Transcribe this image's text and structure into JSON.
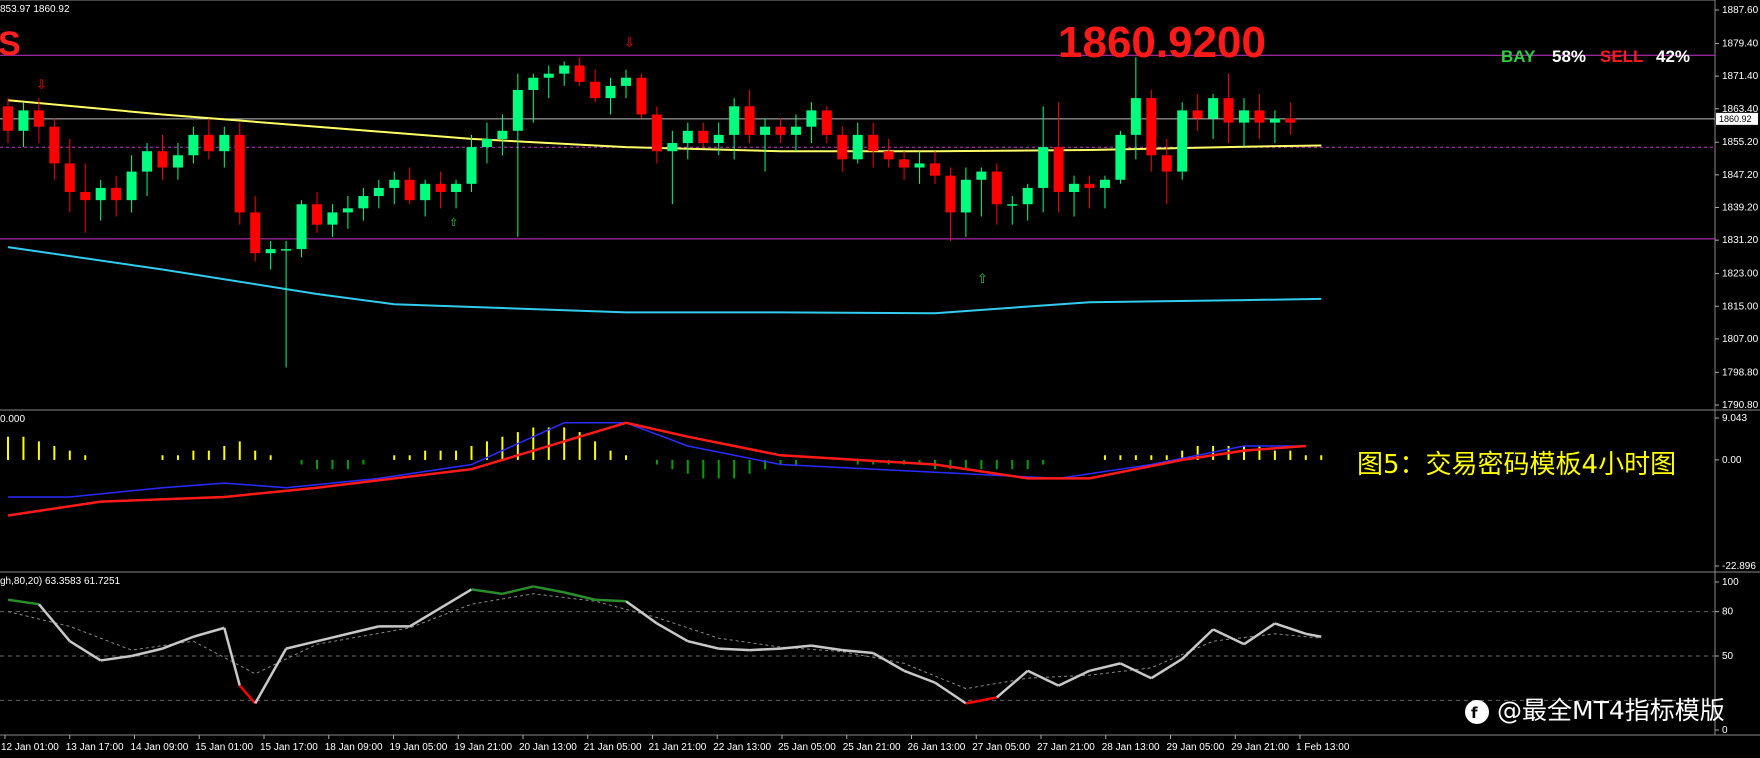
{
  "header": {
    "prices_text": "853.97 1860.92",
    "signal_letter": "S",
    "current_price_big": "1860.9200",
    "bay_label": "BAY",
    "bay_pct": "58%",
    "sell_label": "SELL",
    "sell_pct": "42%"
  },
  "annotation": "图5：交易密码模板4小时图",
  "watermark": "@最全MT4指标模版",
  "colors": {
    "bull": "#00ff7f",
    "bear": "#ff0000",
    "ma": "#ffff66",
    "band_low": "#33ccee",
    "band_line": "#cc33cc",
    "macd_main": "#ff1a1a",
    "macd_signal": "#2b2bff",
    "hist_pos": "#ffff00",
    "hist_neg": "#00a000",
    "stoch_main": "#c8c8c8",
    "stoch_up": "#2a8c2a",
    "stoch_down": "#ff0000",
    "text": "#ffffff",
    "annotation": "#ffff00",
    "price_big": "#ff0000"
  },
  "chart_data": [
    {
      "type": "candlestick",
      "ylim": [
        1790.8,
        1887.6
      ],
      "yticks": [
        "1887.60",
        "1879.40",
        "1871.40",
        "1863.40",
        "1855.20",
        "1847.20",
        "1839.20",
        "1831.20",
        "1823.00",
        "1815.00",
        "1807.00",
        "1798.80",
        "1790.80"
      ],
      "last_price_label": "1860.92",
      "xticks": [
        "12 Jan 01:00",
        "13 Jan 17:00",
        "14 Jan 09:00",
        "15 Jan 01:00",
        "15 Jan 17:00",
        "18 Jan 09:00",
        "19 Jan 05:00",
        "19 Jan 21:00",
        "20 Jan 13:00",
        "21 Jan 05:00",
        "21 Jan 21:00",
        "22 Jan 13:00",
        "25 Jan 05:00",
        "25 Jan 21:00",
        "26 Jan 13:00",
        "27 Jan 05:00",
        "27 Jan 21:00",
        "28 Jan 13:00",
        "29 Jan 05:00",
        "29 Jan 21:00",
        "1 Feb 13:00"
      ],
      "resistance": 1876.5,
      "support": 1831.5,
      "current_price": 1860.92,
      "dashed_level": 1853.97,
      "candles": [
        [
          1864,
          1866,
          1855,
          1858
        ],
        [
          1858,
          1865,
          1854,
          1863
        ],
        [
          1863,
          1866,
          1855,
          1859
        ],
        [
          1859,
          1861,
          1846,
          1850
        ],
        [
          1850,
          1856,
          1838,
          1843
        ],
        [
          1843,
          1850,
          1833,
          1841
        ],
        [
          1841,
          1846,
          1836,
          1844
        ],
        [
          1844,
          1847,
          1837,
          1841
        ],
        [
          1841,
          1852,
          1838,
          1848
        ],
        [
          1848,
          1855,
          1842,
          1853
        ],
        [
          1853,
          1857,
          1846,
          1849
        ],
        [
          1849,
          1855,
          1846,
          1852
        ],
        [
          1852,
          1859,
          1850,
          1857
        ],
        [
          1857,
          1861,
          1851,
          1853
        ],
        [
          1853,
          1859,
          1849,
          1857
        ],
        [
          1857,
          1860,
          1835,
          1838
        ],
        [
          1838,
          1842,
          1826,
          1828
        ],
        [
          1828,
          1831,
          1824,
          1829
        ],
        [
          1829,
          1831,
          1800,
          1829
        ],
        [
          1829,
          1841,
          1827,
          1840
        ],
        [
          1840,
          1843,
          1833,
          1835
        ],
        [
          1835,
          1840,
          1832,
          1838
        ],
        [
          1838,
          1842,
          1834,
          1839
        ],
        [
          1839,
          1844,
          1836,
          1842
        ],
        [
          1842,
          1846,
          1839,
          1844
        ],
        [
          1844,
          1848,
          1840,
          1846
        ],
        [
          1846,
          1849,
          1840,
          1841
        ],
        [
          1841,
          1846,
          1837,
          1845
        ],
        [
          1845,
          1848,
          1839,
          1843
        ],
        [
          1843,
          1846,
          1839,
          1845
        ],
        [
          1845,
          1857,
          1843,
          1854
        ],
        [
          1854,
          1860,
          1850,
          1856
        ],
        [
          1856,
          1862,
          1852,
          1858
        ],
        [
          1858,
          1872,
          1832,
          1868
        ],
        [
          1868,
          1872,
          1860,
          1871
        ],
        [
          1871,
          1874,
          1866,
          1872
        ],
        [
          1872,
          1875,
          1869,
          1874
        ],
        [
          1874,
          1876,
          1869,
          1870
        ],
        [
          1870,
          1873,
          1865,
          1866
        ],
        [
          1866,
          1871,
          1862,
          1869
        ],
        [
          1869,
          1873,
          1866,
          1871
        ],
        [
          1871,
          1872,
          1861,
          1862
        ],
        [
          1862,
          1864,
          1850,
          1853
        ],
        [
          1853,
          1858,
          1840,
          1855
        ],
        [
          1855,
          1860,
          1851,
          1858
        ],
        [
          1858,
          1860,
          1854,
          1855
        ],
        [
          1855,
          1860,
          1852,
          1857
        ],
        [
          1857,
          1866,
          1851,
          1864
        ],
        [
          1864,
          1868,
          1855,
          1857
        ],
        [
          1857,
          1861,
          1848,
          1859
        ],
        [
          1859,
          1861,
          1855,
          1857
        ],
        [
          1857,
          1862,
          1853,
          1859
        ],
        [
          1859,
          1865,
          1855,
          1863
        ],
        [
          1863,
          1864,
          1855,
          1857
        ],
        [
          1857,
          1859,
          1848,
          1851
        ],
        [
          1851,
          1860,
          1850,
          1857
        ],
        [
          1857,
          1860,
          1849,
          1853
        ],
        [
          1853,
          1856,
          1849,
          1851
        ],
        [
          1851,
          1853,
          1846,
          1849
        ],
        [
          1849,
          1853,
          1845,
          1850
        ],
        [
          1850,
          1853,
          1845,
          1847
        ],
        [
          1847,
          1849,
          1831,
          1838
        ],
        [
          1838,
          1849,
          1832,
          1846
        ],
        [
          1846,
          1849,
          1837,
          1848
        ],
        [
          1848,
          1850,
          1835,
          1840
        ],
        [
          1840,
          1842,
          1835,
          1840
        ],
        [
          1840,
          1845,
          1836,
          1844
        ],
        [
          1844,
          1864,
          1838,
          1854
        ],
        [
          1854,
          1865,
          1838,
          1843
        ],
        [
          1843,
          1847,
          1837,
          1845
        ],
        [
          1845,
          1847,
          1839,
          1844
        ],
        [
          1844,
          1847,
          1839,
          1846
        ],
        [
          1846,
          1858,
          1845,
          1857
        ],
        [
          1857,
          1876,
          1851,
          1866
        ],
        [
          1866,
          1868,
          1848,
          1852
        ],
        [
          1852,
          1856,
          1840,
          1848
        ],
        [
          1848,
          1865,
          1846,
          1863
        ],
        [
          1863,
          1867,
          1858,
          1861
        ],
        [
          1861,
          1867,
          1856,
          1866
        ],
        [
          1866,
          1872,
          1855,
          1860
        ],
        [
          1860,
          1866,
          1854,
          1863
        ],
        [
          1863,
          1867,
          1856,
          1860
        ],
        [
          1860,
          1863,
          1855,
          1861
        ],
        [
          1861,
          1865,
          1857,
          1860
        ]
      ],
      "ma": [
        [
          0,
          1865.5
        ],
        [
          10,
          1862
        ],
        [
          20,
          1859
        ],
        [
          30,
          1856
        ],
        [
          40,
          1854
        ],
        [
          50,
          1853
        ],
        [
          60,
          1853
        ],
        [
          70,
          1853.3
        ],
        [
          80,
          1854.1
        ],
        [
          85,
          1854.4
        ]
      ],
      "lower_band": [
        [
          0,
          1829.5
        ],
        [
          10,
          1824
        ],
        [
          20,
          1818
        ],
        [
          25,
          1815.5
        ],
        [
          40,
          1813.5
        ],
        [
          50,
          1813.5
        ],
        [
          60,
          1813.3
        ],
        [
          70,
          1816
        ],
        [
          80,
          1816.5
        ],
        [
          85,
          1816.8
        ]
      ]
    },
    {
      "type": "macd",
      "ylim": [
        -22.896,
        9.043
      ],
      "yticks": [
        "9.043",
        "0.00",
        "-22.896"
      ],
      "label_left": "0.000",
      "hist": [
        5,
        5,
        4,
        3,
        2,
        1,
        0,
        0,
        0,
        0,
        1,
        1,
        2,
        2,
        3,
        4,
        2,
        1,
        0,
        -1,
        -2,
        -2,
        -2,
        -1,
        0,
        1,
        1,
        2,
        2,
        2,
        3,
        4,
        5,
        6,
        7,
        7,
        7,
        6,
        4,
        2,
        1,
        0,
        -1,
        -2,
        -3,
        -4,
        -4,
        -4,
        -3,
        -2,
        -1,
        -1,
        0,
        0,
        0,
        -1,
        -1,
        -1,
        -1,
        -1,
        -2,
        -2,
        -2,
        -2,
        -2,
        -2,
        -2,
        -1,
        0,
        0,
        0,
        1,
        1,
        1,
        1,
        1,
        2,
        3,
        3,
        3,
        3,
        3,
        2,
        2,
        1,
        1
      ],
      "main": [
        [
          0,
          -12
        ],
        [
          6,
          -9
        ],
        [
          14,
          -8
        ],
        [
          20,
          -6
        ],
        [
          30,
          -2
        ],
        [
          38,
          6
        ],
        [
          40,
          8
        ],
        [
          44,
          5
        ],
        [
          50,
          1
        ],
        [
          60,
          -1
        ],
        [
          66,
          -4
        ],
        [
          70,
          -4
        ],
        [
          76,
          0
        ],
        [
          80,
          2
        ],
        [
          84,
          3
        ]
      ],
      "signal": [
        [
          0,
          -8
        ],
        [
          4,
          -8
        ],
        [
          10,
          -6
        ],
        [
          14,
          -5
        ],
        [
          18,
          -6
        ],
        [
          24,
          -4
        ],
        [
          30,
          -1
        ],
        [
          36,
          8
        ],
        [
          40,
          8
        ],
        [
          44,
          3
        ],
        [
          50,
          -1
        ],
        [
          62,
          -3
        ],
        [
          68,
          -4
        ],
        [
          74,
          -1
        ],
        [
          80,
          3
        ],
        [
          84,
          3
        ]
      ]
    },
    {
      "type": "stochastic",
      "ylim": [
        0,
        100
      ],
      "yticks": [
        "100",
        "80",
        "50",
        "0"
      ],
      "label_left": "gh,80,20) 63.3583 61.7251",
      "main": [
        [
          0,
          88
        ],
        [
          2,
          85
        ],
        [
          4,
          60
        ],
        [
          6,
          47
        ],
        [
          8,
          50
        ],
        [
          10,
          55
        ],
        [
          12,
          63
        ],
        [
          14,
          69
        ],
        [
          15,
          30
        ],
        [
          16,
          18
        ],
        [
          18,
          55
        ],
        [
          20,
          60
        ],
        [
          24,
          70
        ],
        [
          26,
          70
        ],
        [
          30,
          95
        ],
        [
          32,
          92
        ],
        [
          34,
          97
        ],
        [
          36,
          93
        ],
        [
          38,
          88
        ],
        [
          40,
          87
        ],
        [
          42,
          72
        ],
        [
          44,
          60
        ],
        [
          46,
          55
        ],
        [
          48,
          54
        ],
        [
          50,
          55
        ],
        [
          52,
          57
        ],
        [
          54,
          54
        ],
        [
          56,
          52
        ],
        [
          58,
          40
        ],
        [
          60,
          32
        ],
        [
          62,
          18
        ],
        [
          64,
          22
        ],
        [
          66,
          40
        ],
        [
          68,
          30
        ],
        [
          70,
          40
        ],
        [
          72,
          45
        ],
        [
          74,
          35
        ],
        [
          76,
          48
        ],
        [
          78,
          68
        ],
        [
          80,
          58
        ],
        [
          82,
          72
        ],
        [
          84,
          65
        ],
        [
          85,
          63
        ]
      ],
      "signal": [
        [
          0,
          80
        ],
        [
          4,
          70
        ],
        [
          8,
          54
        ],
        [
          12,
          60
        ],
        [
          16,
          38
        ],
        [
          20,
          58
        ],
        [
          26,
          69
        ],
        [
          30,
          85
        ],
        [
          34,
          92
        ],
        [
          38,
          87
        ],
        [
          42,
          76
        ],
        [
          46,
          62
        ],
        [
          50,
          56
        ],
        [
          54,
          53
        ],
        [
          58,
          45
        ],
        [
          62,
          28
        ],
        [
          66,
          35
        ],
        [
          70,
          37
        ],
        [
          74,
          42
        ],
        [
          78,
          60
        ],
        [
          82,
          65
        ],
        [
          85,
          62
        ]
      ]
    }
  ]
}
